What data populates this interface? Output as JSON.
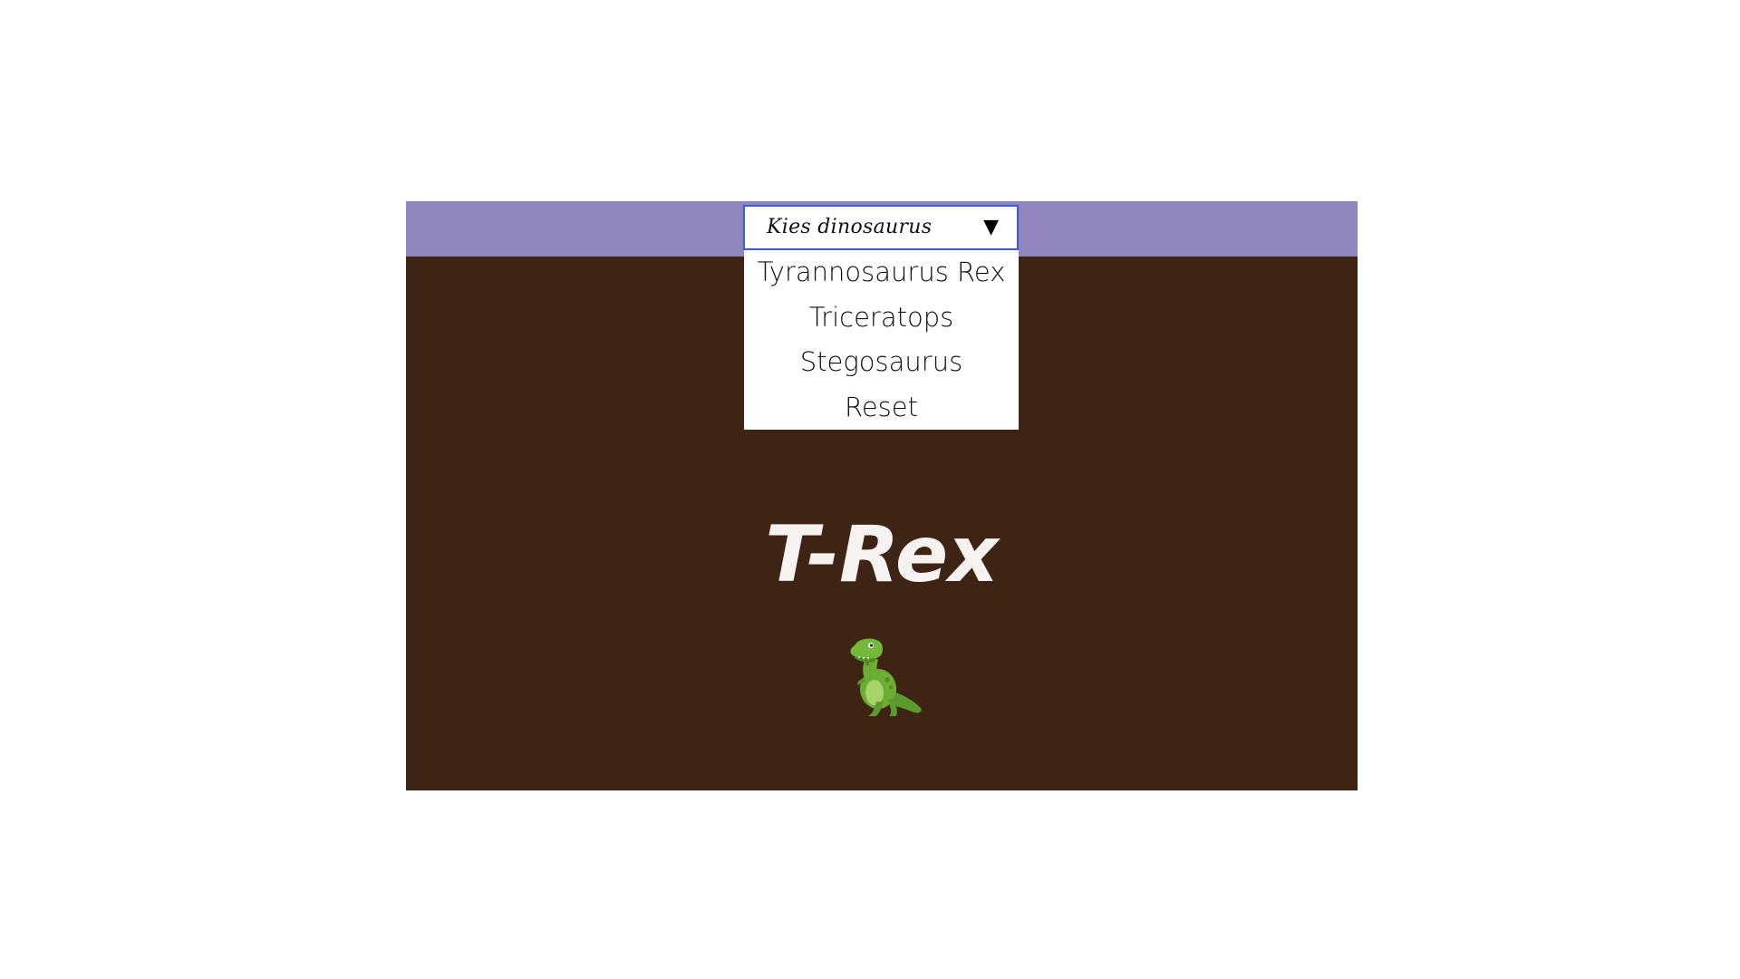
{
  "topbar": {
    "dropdown": {
      "label": "Kies dinosaurus",
      "arrow": "▼",
      "options": [
        "Tyrannosaurus Rex",
        "Triceratops",
        "Stegosaurus",
        "Reset"
      ]
    }
  },
  "main": {
    "title": "T-Rex",
    "image_icon": "t-rex-icon"
  },
  "colors": {
    "topbar": "#9085bc",
    "background": "#3d2415",
    "dropdown_border": "#3b5bdb",
    "title": "#f6f2ef"
  }
}
